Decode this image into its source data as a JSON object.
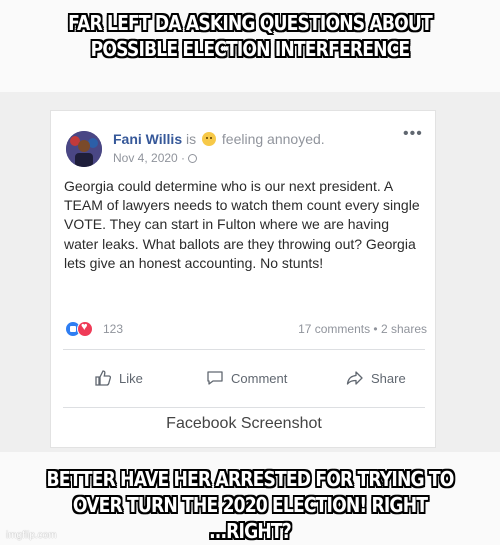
{
  "meme": {
    "top_text": "FAR LEFT DA ASKING QUESTIONS ABOUT POSSIBLE ELECTION INTERFERENCE",
    "bottom_text": "BETTER HAVE HER ARRESTED FOR TRYING TO OVER TURN THE 2020 ELECTION!  RIGHT ...RIGHT?",
    "watermark": "imgflip.com"
  },
  "post": {
    "author": "Fani Willis",
    "is": "is",
    "feeling": "feeling annoyed.",
    "emoji_icon": "annoyed-face-icon",
    "date": "Nov 4, 2020 ·",
    "more": "•••",
    "text": "Georgia could determine who is our next president.  A TEAM of lawyers needs to watch them count every single VOTE.  They can start in Fulton where we are having water leaks. What ballots are they throwing out?  Georgia lets give an honest accounting.  No stunts!",
    "reaction_count": "123",
    "comments_shares": "17 comments • 2 shares",
    "actions": {
      "like": "Like",
      "comment": "Comment",
      "share": "Share"
    }
  },
  "caption": "Facebook Screenshot",
  "colors": {
    "name": "#365899",
    "like_blue": "#2f7ef2",
    "love_red": "#ef3b57"
  }
}
